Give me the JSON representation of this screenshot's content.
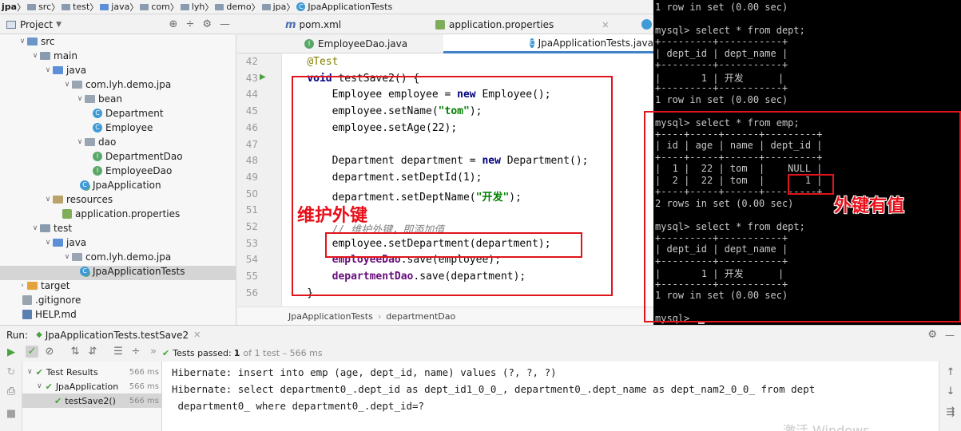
{
  "breadcrumb": {
    "items": [
      "jpa",
      "src",
      "test",
      "java",
      "com",
      "lyh",
      "demo",
      "jpa",
      "JpaApplicationTests"
    ]
  },
  "project_panel": {
    "title": "Project",
    "tree": [
      {
        "label": "src",
        "arrow": "v",
        "kind": "src"
      },
      {
        "label": "main",
        "arrow": "v",
        "kind": "folder"
      },
      {
        "label": "java",
        "arrow": "v",
        "kind": "java"
      },
      {
        "label": "com.lyh.demo.jpa",
        "arrow": "v",
        "kind": "pkg"
      },
      {
        "label": "bean",
        "arrow": "v",
        "kind": "pkg"
      },
      {
        "label": "Department",
        "arrow": "",
        "kind": "class"
      },
      {
        "label": "Employee",
        "arrow": "",
        "kind": "class"
      },
      {
        "label": "dao",
        "arrow": "v",
        "kind": "pkg"
      },
      {
        "label": "DepartmentDao",
        "arrow": "",
        "kind": "iface"
      },
      {
        "label": "EmployeeDao",
        "arrow": "",
        "kind": "iface"
      },
      {
        "label": "JpaApplication",
        "arrow": "",
        "kind": "app"
      },
      {
        "label": "resources",
        "arrow": "v",
        "kind": "res"
      },
      {
        "label": "application.properties",
        "arrow": "",
        "kind": "props"
      },
      {
        "label": "test",
        "arrow": "v",
        "kind": "folder"
      },
      {
        "label": "java",
        "arrow": "v",
        "kind": "java"
      },
      {
        "label": "com.lyh.demo.jpa",
        "arrow": "v",
        "kind": "pkg"
      },
      {
        "label": "JpaApplicationTests",
        "arrow": "",
        "kind": "app"
      },
      {
        "label": "target",
        "arrow": ">",
        "kind": "tgt"
      },
      {
        "label": ".gitignore",
        "arrow": "",
        "kind": "file"
      },
      {
        "label": "HELP.md",
        "arrow": "",
        "kind": "md"
      }
    ]
  },
  "tabs_row1": [
    {
      "label": "pom.xml",
      "icon": "m"
    },
    {
      "label": "application.properties",
      "icon": "props"
    }
  ],
  "tabs_row2": [
    {
      "label": "EmployeeDao.java",
      "icon": "I"
    },
    {
      "label": "JpaApplicationTests.java",
      "icon": "C"
    }
  ],
  "editor": {
    "line_numbers": [
      "42",
      "43",
      "44",
      "45",
      "46",
      "47",
      "48",
      "49",
      "50",
      "51",
      "52",
      "53",
      "54",
      "55",
      "56"
    ],
    "lines": [
      [
        {
          "t": "    "
        },
        {
          "t": "@Test",
          "c": "ann"
        }
      ],
      [
        {
          "t": "    "
        },
        {
          "t": "void",
          "c": "kw"
        },
        {
          "t": " testSave2() {"
        }
      ],
      [
        {
          "t": "        Employee employee = "
        },
        {
          "t": "new",
          "c": "kw"
        },
        {
          "t": " Employee();"
        }
      ],
      [
        {
          "t": "        employee.setName("
        },
        {
          "t": "\"tom\"",
          "c": "str"
        },
        {
          "t": ");"
        }
      ],
      [
        {
          "t": "        employee.setAge(22);"
        }
      ],
      [
        {
          "t": ""
        }
      ],
      [
        {
          "t": "        Department department = "
        },
        {
          "t": "new",
          "c": "kw"
        },
        {
          "t": " Department();"
        }
      ],
      [
        {
          "t": "        department.setDeptId(1);"
        }
      ],
      [
        {
          "t": "        department.setDeptName("
        },
        {
          "t": "\"开发\"",
          "c": "str"
        },
        {
          "t": ");"
        }
      ],
      [
        {
          "t": ""
        }
      ],
      [
        {
          "t": "        "
        },
        {
          "t": "// 维护外键，即添加值",
          "c": "cmt"
        }
      ],
      [
        {
          "t": "        employee.setDepartment(department);"
        }
      ],
      [
        {
          "t": "        "
        },
        {
          "t": "employeeDao",
          "c": "fld"
        },
        {
          "t": ".save(employee);"
        }
      ],
      [
        {
          "t": "        "
        },
        {
          "t": "departmentDao",
          "c": "fld"
        },
        {
          "t": ".save(department);"
        }
      ],
      [
        {
          "t": "    }"
        }
      ]
    ],
    "crumbs": [
      "JpaApplicationTests",
      "departmentDao"
    ]
  },
  "terminal": {
    "lines": [
      "1 row in set (0.00 sec)",
      "",
      "mysql> select * from dept;",
      "+---------+-----------+",
      "| dept_id | dept_name |",
      "+---------+-----------+",
      "|       1 | 开发      |",
      "+---------+-----------+",
      "1 row in set (0.00 sec)",
      "",
      "mysql> select * from emp;",
      "+----+-----+------+---------+",
      "| id | age | name | dept_id |",
      "+----+-----+------+---------+",
      "|  1 |  22 | tom  |    NULL |",
      "|  2 |  22 | tom  |       1 |",
      "+----+-----+------+---------+",
      "2 rows in set (0.00 sec)",
      "",
      "mysql> select * from dept;",
      "+---------+-----------+",
      "| dept_id | dept_name |",
      "+---------+-----------+",
      "|       1 | 开发      |",
      "+---------+-----------+",
      "1 row in set (0.00 sec)",
      "",
      "mysql> "
    ]
  },
  "annotations": {
    "maintain_fk": "维护外键",
    "fk_has_value": "外键有值"
  },
  "run_panel": {
    "label": "Run:",
    "config": "JpaApplicationTests.testSave2",
    "status_prefix": "Tests passed:",
    "status_count": "1",
    "status_rest": "of 1 test – 566 ms",
    "tree": [
      {
        "label": "Test Results",
        "duration": "566 ms"
      },
      {
        "label": "JpaApplication",
        "duration": "566 ms"
      },
      {
        "label": "testSave2()",
        "duration": "566 ms"
      }
    ],
    "console": [
      "Hibernate: insert into emp (age, dept_id, name) values (?, ?, ?)",
      "Hibernate: select department0_.dept_id as dept_id1_0_0_, department0_.dept_name as dept_nam2_0_0_ from dept",
      " department0_ where department0_.dept_id=?"
    ],
    "watermark": "激活 Windows"
  },
  "colors": {
    "annotation_red": "#e0141c",
    "pass_green": "#49a33d",
    "keyword": "#000080",
    "string": "#008000"
  }
}
